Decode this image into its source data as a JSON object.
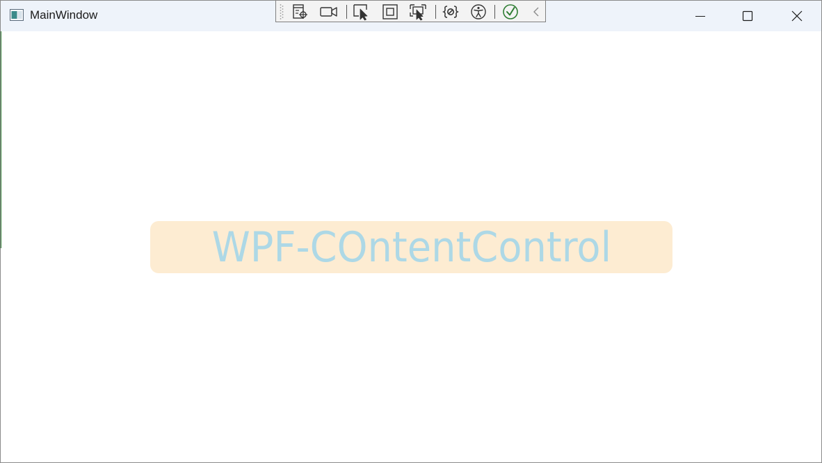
{
  "window": {
    "title": "MainWindow"
  },
  "caption_buttons": {
    "minimize": "minimize-icon",
    "maximize": "maximize-icon",
    "close": "close-icon"
  },
  "dev_toolbar": {
    "items": [
      "go-to-live-visual-tree-icon",
      "record-icon",
      "select-element-icon",
      "display-layout-adorners-icon",
      "track-focused-element-icon",
      "binding-failures-icon",
      "accessibility-scan-icon",
      "checkmark-icon",
      "collapse-chevron-icon"
    ]
  },
  "content": {
    "text": "WPF-COntentControl",
    "background": "#FDECD2",
    "foreground": "#ADD8E6"
  }
}
